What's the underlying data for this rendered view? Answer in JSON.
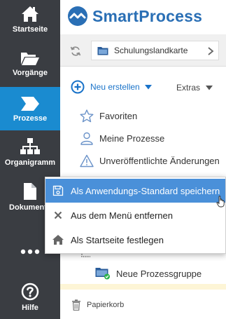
{
  "nav": {
    "items": [
      {
        "label": "Startseite",
        "icon": "home-icon"
      },
      {
        "label": "Vorgänge",
        "icon": "folder-open-icon"
      },
      {
        "label": "Prozesse",
        "icon": "process-chevron-icon",
        "active": true
      },
      {
        "label": "Organigramm",
        "icon": "org-chart-icon"
      },
      {
        "label": "Dokumente",
        "icon": "document-icon"
      },
      {
        "label": "",
        "icon": "more-dots-icon"
      },
      {
        "label": "Hilfe",
        "icon": "help-icon"
      }
    ]
  },
  "header": {
    "logo_text": "SmartProcess"
  },
  "breadcrumb": {
    "label": "Schulungslandkarte"
  },
  "toolbar": {
    "new_label": "Neu erstellen",
    "extras_label": "Extras"
  },
  "menu": {
    "items": [
      {
        "label": "Favoriten",
        "icon": "star-icon"
      },
      {
        "label": "Meine Prozesse",
        "icon": "user-icon"
      },
      {
        "label": "Unveröffentlichte Änderungen",
        "icon": "warning-icon"
      }
    ]
  },
  "context_menu": {
    "items": [
      {
        "label": "Als Anwendungs-Standard speichern",
        "icon": "save-icon",
        "highlighted": true
      },
      {
        "label": "Aus dem Menü entfernen",
        "icon": "close-icon"
      },
      {
        "label": "Als Startseite festlegen",
        "icon": "home-icon"
      }
    ]
  },
  "tree": {
    "item_label": "Neue Prozessgruppe"
  },
  "trash": {
    "label": "Papierkorb"
  },
  "colors": {
    "nav_bg": "#3a3d42",
    "nav_active": "#1a8bd0",
    "accent": "#1a73c9",
    "highlight": "#4a90d9",
    "status_green": "#2bb24c"
  }
}
